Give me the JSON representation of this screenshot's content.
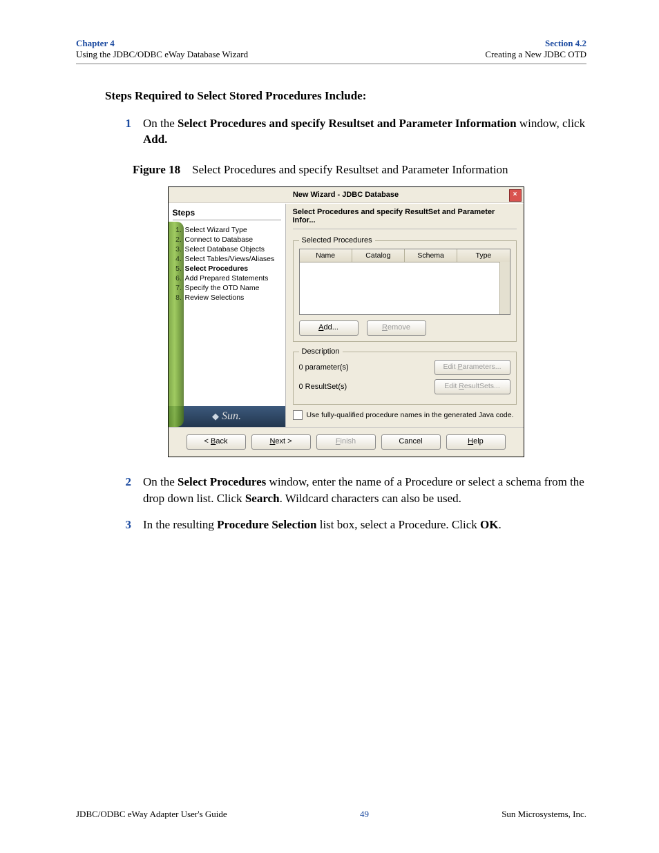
{
  "header": {
    "chapter": "Chapter 4",
    "chapter_sub": "Using the JDBC/ODBC eWay Database Wizard",
    "section": "Section 4.2",
    "section_sub": "Creating a New JDBC OTD"
  },
  "content": {
    "heading": "Steps Required to Select Stored Procedures Include:",
    "steps": [
      {
        "num": "1",
        "parts": [
          {
            "t": "On the "
          },
          {
            "t": "Select Procedures and specify Resultset and Parameter Information",
            "bold": true
          },
          {
            "t": " window, click "
          },
          {
            "t": "Add.",
            "bold": true
          }
        ]
      },
      {
        "num": "2",
        "parts": [
          {
            "t": "On the "
          },
          {
            "t": "Select Procedures",
            "bold": true
          },
          {
            "t": " window, enter the name of a Procedure or select a schema from the drop down list. Click "
          },
          {
            "t": "Search",
            "bold": true
          },
          {
            "t": ". Wildcard characters can also be used."
          }
        ]
      },
      {
        "num": "3",
        "parts": [
          {
            "t": "In the resulting "
          },
          {
            "t": "Procedure Selection",
            "bold": true
          },
          {
            "t": " list box, select a Procedure. Click "
          },
          {
            "t": "OK",
            "bold": true
          },
          {
            "t": "."
          }
        ]
      }
    ],
    "figure": {
      "label": "Figure 18",
      "caption": "Select Procedures and specify Resultset and Parameter Information"
    }
  },
  "dialog": {
    "title": "New Wizard - JDBC Database",
    "close_x": "×",
    "steps_title": "Steps",
    "steps_list": [
      {
        "n": "1.",
        "label": "Select Wizard Type"
      },
      {
        "n": "2.",
        "label": "Connect to Database"
      },
      {
        "n": "3.",
        "label": "Select Database Objects"
      },
      {
        "n": "4.",
        "label": "Select Tables/Views/Aliases"
      },
      {
        "n": "5.",
        "label": "Select Procedures",
        "current": true
      },
      {
        "n": "6.",
        "label": "Add Prepared Statements"
      },
      {
        "n": "7.",
        "label": "Specify the OTD Name"
      },
      {
        "n": "8.",
        "label": "Review Selections"
      }
    ],
    "brand": "Sun.",
    "main_title": "Select Procedures and specify ResultSet and Parameter Infor...",
    "group1_legend": "Selected Procedures",
    "columns": [
      "Name",
      "Catalog",
      "Schema",
      "Type"
    ],
    "add_btn": "Add...",
    "remove_btn": "Remove",
    "group2_legend": "Description",
    "param_text": "0 parameter(s)",
    "resultset_text": "0 ResultSet(s)",
    "edit_params_btn": "Edit Parameters...",
    "edit_results_btn": "Edit ResultSets...",
    "cb_label": "Use fully-qualified procedure names in the generated Java code.",
    "footer": {
      "back": "< Back",
      "next": "Next >",
      "finish": "Finish",
      "cancel": "Cancel",
      "help": "Help"
    }
  },
  "footer": {
    "left": "JDBC/ODBC eWay Adapter User's Guide",
    "center": "49",
    "right": "Sun Microsystems, Inc."
  }
}
